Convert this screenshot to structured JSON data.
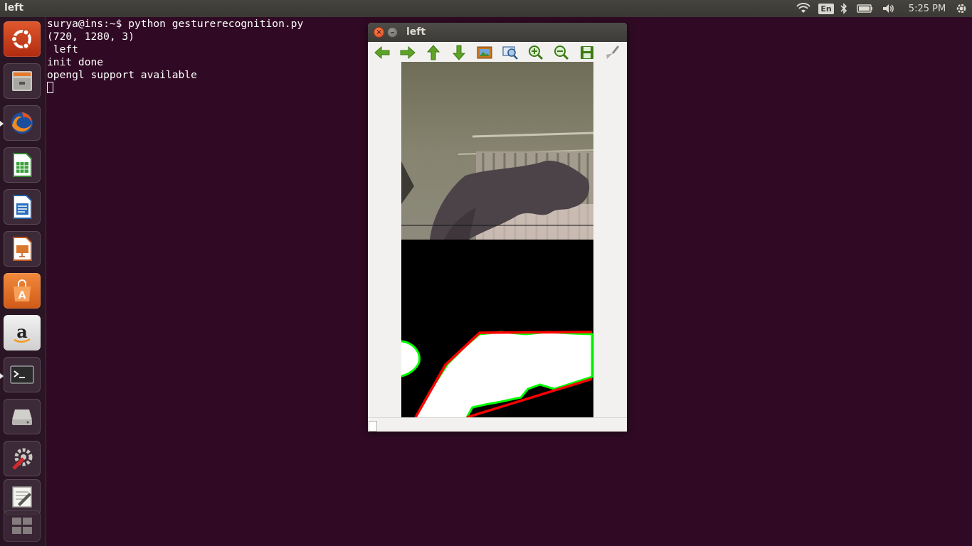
{
  "panel": {
    "title": "left",
    "clock": "5:25 PM",
    "language": "En"
  },
  "launcher": {
    "items": [
      {
        "name": "dash-home"
      },
      {
        "name": "files"
      },
      {
        "name": "firefox"
      },
      {
        "name": "libreoffice-calc"
      },
      {
        "name": "libreoffice-writer"
      },
      {
        "name": "libreoffice-impress"
      },
      {
        "name": "software-center"
      },
      {
        "name": "amazon"
      },
      {
        "name": "terminal"
      },
      {
        "name": "disks"
      },
      {
        "name": "system-settings"
      },
      {
        "name": "text-editor"
      },
      {
        "name": "workspace-switcher"
      }
    ]
  },
  "terminal": {
    "lines": [
      "surya@ins:~$ python gesturerecognition.py",
      "(720, 1280, 3)",
      " left",
      "init done",
      "opengl support available"
    ]
  },
  "window": {
    "title": "left",
    "toolbar": [
      {
        "icon": "arrow-left-icon"
      },
      {
        "icon": "arrow-right-icon"
      },
      {
        "icon": "arrow-up-icon"
      },
      {
        "icon": "arrow-down-icon"
      },
      {
        "icon": "image-fit-icon"
      },
      {
        "icon": "zoom-region-icon"
      },
      {
        "icon": "zoom-in-icon"
      },
      {
        "icon": "zoom-out-icon"
      },
      {
        "icon": "save-icon"
      },
      {
        "icon": "properties-brush-icon"
      }
    ]
  },
  "colors": {
    "desktop": "#300a24",
    "contour_green": "#00ff00",
    "hull_red": "#ff0000"
  }
}
